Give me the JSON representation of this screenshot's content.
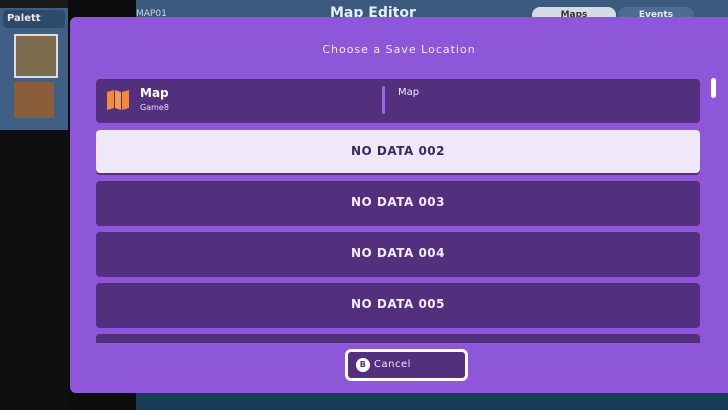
{
  "background": {
    "palette_tab": "Palett",
    "header_left": "MAP01",
    "title": "Map Editor",
    "tabs": [
      "Maps",
      "Events"
    ]
  },
  "dialog": {
    "title": "Choose a Save Location",
    "slots": [
      {
        "name": "Map",
        "sub": "Game8",
        "description": "Map",
        "icon": "map-icon"
      },
      {
        "label": "NO DATA 002",
        "selected": true
      },
      {
        "label": "NO DATA 003"
      },
      {
        "label": "NO DATA 004"
      },
      {
        "label": "NO DATA 005"
      }
    ],
    "cancel": {
      "badge": "B",
      "label": "Cancel"
    }
  },
  "colors": {
    "dialog_bg": "#8e56d8",
    "slot_bg": "#52307e",
    "slot_selected_bg": "#efe8f8",
    "map_icon": "#f08a3c"
  }
}
